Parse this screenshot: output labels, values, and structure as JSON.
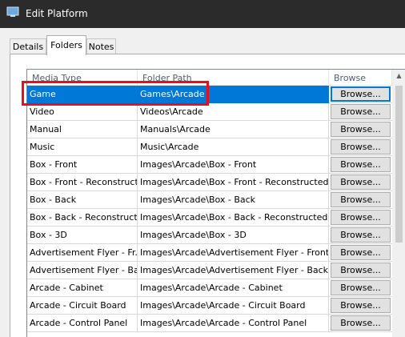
{
  "window": {
    "title": "Edit Platform",
    "app_icon": "window-icon"
  },
  "tabs": [
    {
      "label": "Details",
      "active": false
    },
    {
      "label": "Folders",
      "active": true
    },
    {
      "label": "Notes",
      "active": false
    }
  ],
  "grid": {
    "columns": [
      "Media Type",
      "Folder Path",
      "Browse"
    ],
    "rows": [
      {
        "media_type": "Game",
        "folder_path": "Games\\Arcade",
        "button": "Browse...",
        "selected": true
      },
      {
        "media_type": "Video",
        "folder_path": "Videos\\Arcade",
        "button": "Browse..."
      },
      {
        "media_type": "Manual",
        "folder_path": "Manuals\\Arcade",
        "button": "Browse..."
      },
      {
        "media_type": "Music",
        "folder_path": "Music\\Arcade",
        "button": "Browse..."
      },
      {
        "media_type": "Box - Front",
        "folder_path": "Images\\Arcade\\Box - Front",
        "button": "Browse..."
      },
      {
        "media_type": "Box - Front - Reconstructed",
        "folder_path": "Images\\Arcade\\Box - Front - Reconstructed",
        "button": "Browse..."
      },
      {
        "media_type": "Box - Back",
        "folder_path": "Images\\Arcade\\Box - Back",
        "button": "Browse..."
      },
      {
        "media_type": "Box - Back - Reconstructed",
        "folder_path": "Images\\Arcade\\Box - Back - Reconstructed",
        "button": "Browse..."
      },
      {
        "media_type": "Box - 3D",
        "folder_path": "Images\\Arcade\\Box - 3D",
        "button": "Browse..."
      },
      {
        "media_type": "Advertisement Flyer - Fr...",
        "folder_path": "Images\\Arcade\\Advertisement Flyer - Front",
        "button": "Browse..."
      },
      {
        "media_type": "Advertisement Flyer - Back",
        "folder_path": "Images\\Arcade\\Advertisement Flyer - Back",
        "button": "Browse..."
      },
      {
        "media_type": "Arcade - Cabinet",
        "folder_path": "Images\\Arcade\\Arcade - Cabinet",
        "button": "Browse..."
      },
      {
        "media_type": "Arcade - Circuit Board",
        "folder_path": "Images\\Arcade\\Arcade - Circuit Board",
        "button": "Browse..."
      },
      {
        "media_type": "Arcade - Control Panel",
        "folder_path": "Images\\Arcade\\Arcade - Control Panel",
        "button": "Browse..."
      }
    ]
  },
  "colors": {
    "selection": "#0078d7",
    "highlight_box": "#e8101d",
    "titlebar": "#2b2b2b"
  }
}
